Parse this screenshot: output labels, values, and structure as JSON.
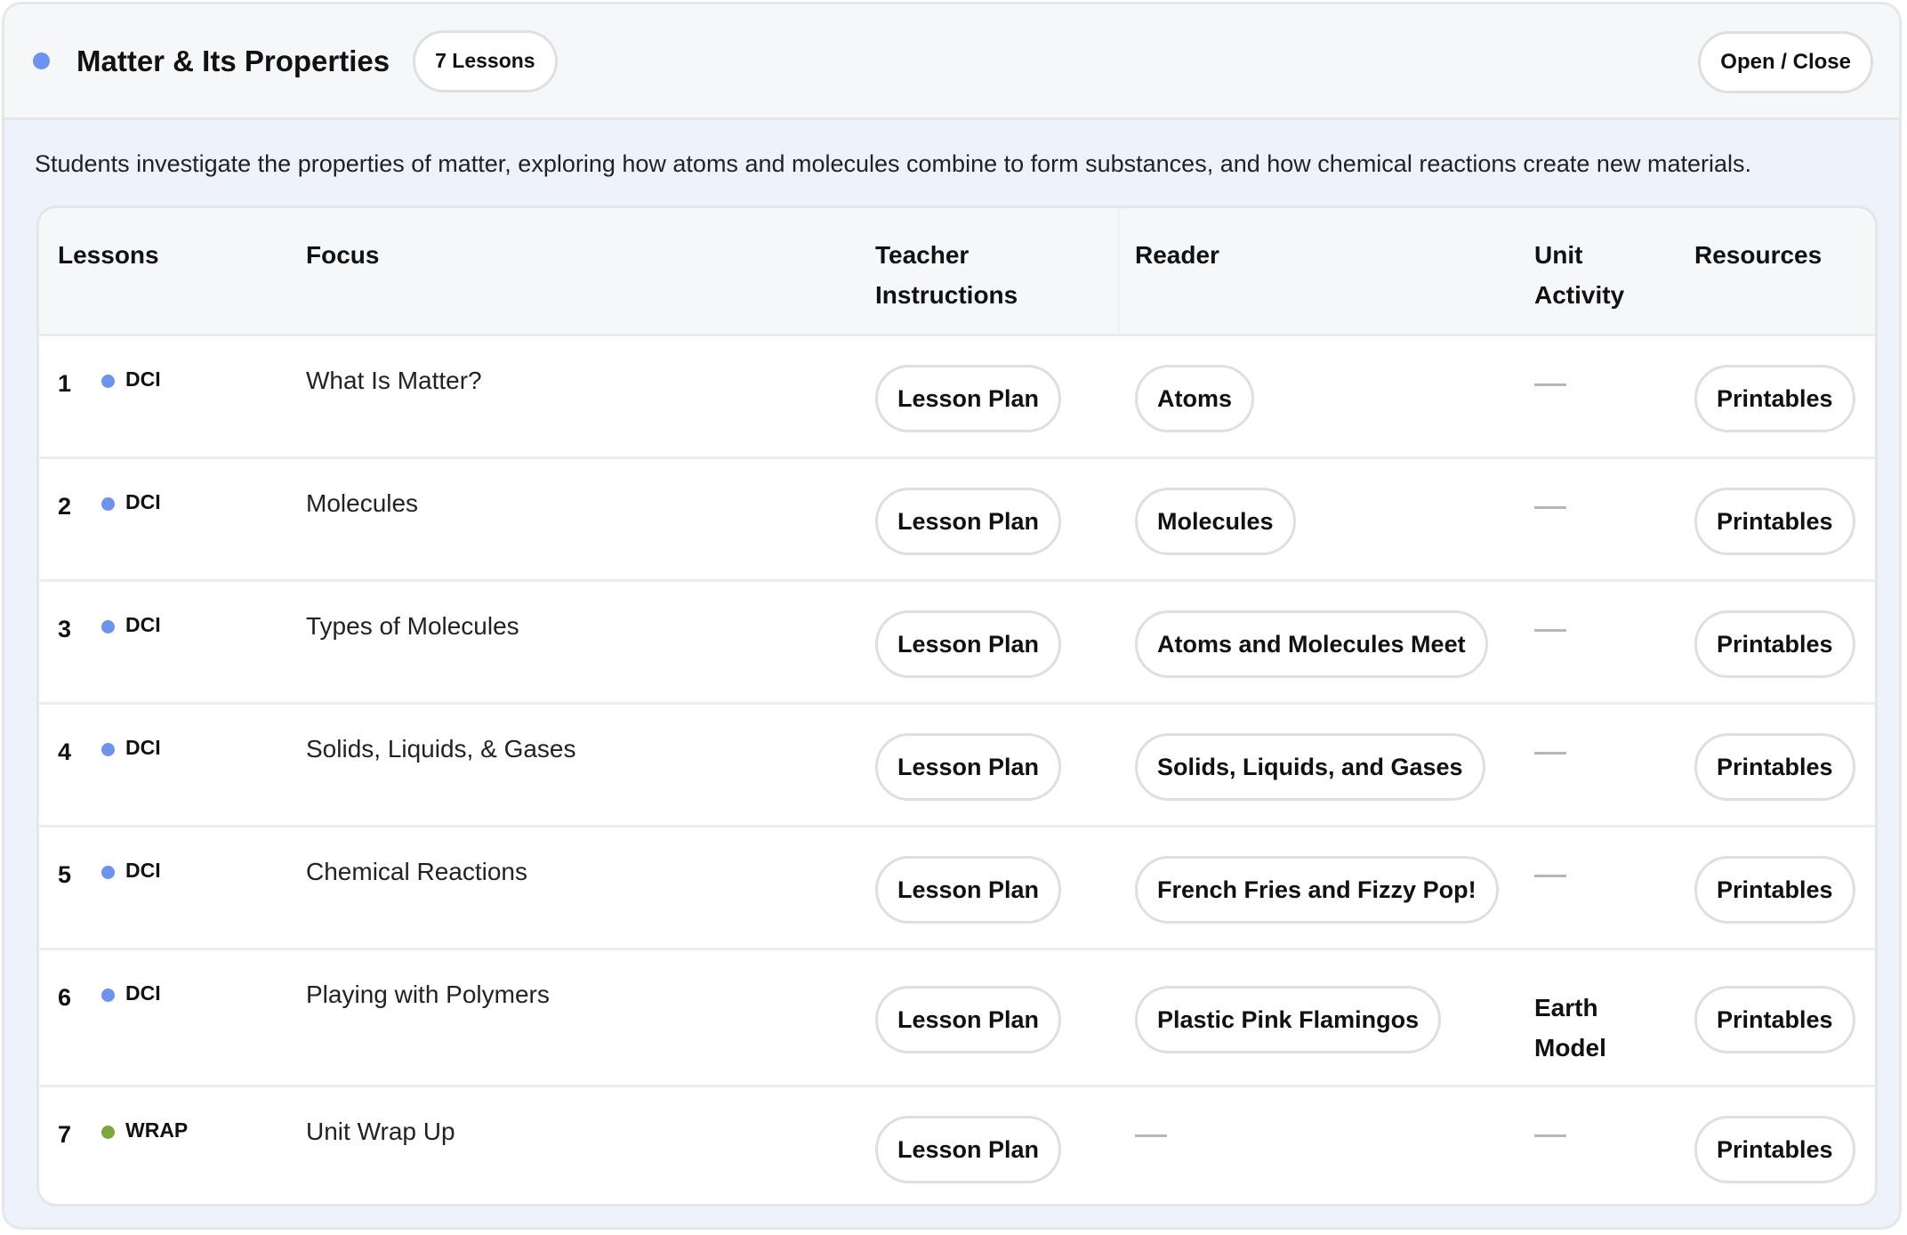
{
  "header": {
    "title": "Matter & Its Properties",
    "lesson_count": "7 Lessons",
    "toggle_label": "Open / Close",
    "status_color": "#6b93f0"
  },
  "description": "Students investigate the properties of matter, exploring how atoms and molecules combine to form substances, and how chemical reactions create new materials.",
  "table": {
    "columns": {
      "lessons": "Lessons",
      "focus": "Focus",
      "teacher_line1": "Teacher",
      "teacher_line2": "Instructions",
      "reader": "Reader",
      "unit_line1": "Unit",
      "unit_line2": "Activity",
      "resources": "Resources"
    },
    "rows": [
      {
        "num": "1",
        "type": "DCI",
        "type_color": "#6b93f0",
        "focus": "What Is Matter?",
        "teacher": "Lesson Plan",
        "reader": "Atoms",
        "unit_line1": "",
        "unit_line2": "",
        "resources": "Printables"
      },
      {
        "num": "2",
        "type": "DCI",
        "type_color": "#6b93f0",
        "focus": "Molecules",
        "teacher": "Lesson Plan",
        "reader": "Molecules",
        "unit_line1": "",
        "unit_line2": "",
        "resources": "Printables"
      },
      {
        "num": "3",
        "type": "DCI",
        "type_color": "#6b93f0",
        "focus": "Types of Molecules",
        "teacher": "Lesson Plan",
        "reader": "Atoms and Molecules Meet",
        "unit_line1": "",
        "unit_line2": "",
        "resources": "Printables"
      },
      {
        "num": "4",
        "type": "DCI",
        "type_color": "#6b93f0",
        "focus": "Solids, Liquids, & Gases",
        "teacher": "Lesson Plan",
        "reader": "Solids, Liquids, and Gases",
        "unit_line1": "",
        "unit_line2": "",
        "resources": "Printables"
      },
      {
        "num": "5",
        "type": "DCI",
        "type_color": "#6b93f0",
        "focus": "Chemical Reactions",
        "teacher": "Lesson Plan",
        "reader": "French Fries and Fizzy Pop!",
        "unit_line1": "",
        "unit_line2": "",
        "resources": "Printables"
      },
      {
        "num": "6",
        "type": "DCI",
        "type_color": "#6b93f0",
        "focus": "Playing with Polymers",
        "teacher": "Lesson Plan",
        "reader": "Plastic Pink Flamingos",
        "unit_line1": "Earth",
        "unit_line2": "Model",
        "resources": "Printables"
      },
      {
        "num": "7",
        "type": "WRAP",
        "type_color": "#7ba83a",
        "focus": "Unit Wrap Up",
        "teacher": "Lesson Plan",
        "reader": "",
        "unit_line1": "",
        "unit_line2": "",
        "resources": "Printables"
      }
    ]
  }
}
